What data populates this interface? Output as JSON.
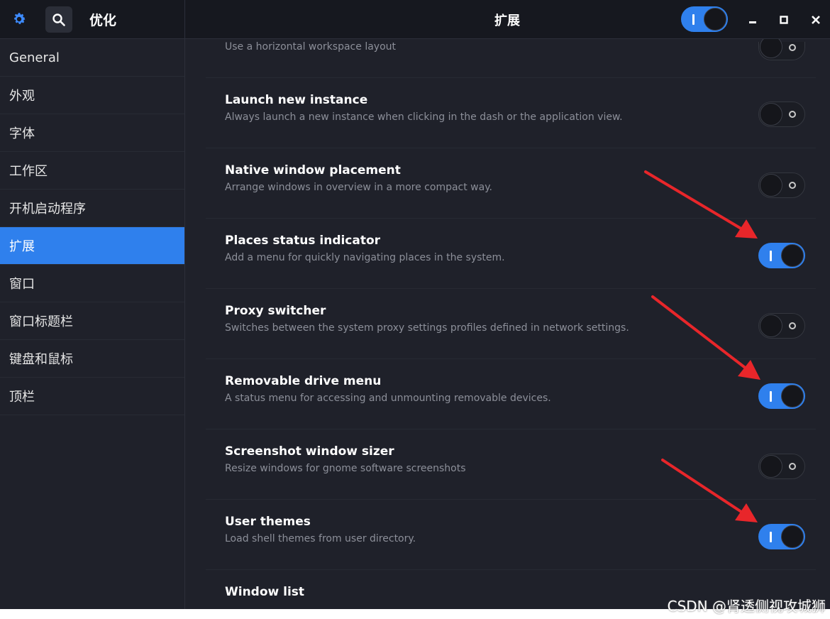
{
  "header": {
    "app_title": "优化",
    "page_title": "扩展",
    "extensions_master_enabled": true
  },
  "sidebar": {
    "items": [
      {
        "label": "General",
        "active": false
      },
      {
        "label": "外观",
        "active": false
      },
      {
        "label": "字体",
        "active": false
      },
      {
        "label": "工作区",
        "active": false
      },
      {
        "label": "开机启动程序",
        "active": false
      },
      {
        "label": "扩展",
        "active": true
      },
      {
        "label": "窗口",
        "active": false
      },
      {
        "label": "窗口标题栏",
        "active": false
      },
      {
        "label": "键盘和鼠标",
        "active": false
      },
      {
        "label": "顶栏",
        "active": false
      }
    ]
  },
  "extensions": [
    {
      "title": "",
      "description": "Use a horizontal workspace layout",
      "enabled": false
    },
    {
      "title": "Launch new instance",
      "description": "Always launch a new instance when clicking in the dash or the application view.",
      "enabled": false
    },
    {
      "title": "Native window placement",
      "description": "Arrange windows in overview in a more compact way.",
      "enabled": false
    },
    {
      "title": "Places status indicator",
      "description": "Add a menu for quickly navigating places in the system.",
      "enabled": true
    },
    {
      "title": "Proxy switcher",
      "description": "Switches between the system proxy settings profiles defined in network settings.",
      "enabled": false
    },
    {
      "title": "Removable drive menu",
      "description": "A status menu for accessing and unmounting removable devices.",
      "enabled": true
    },
    {
      "title": "Screenshot window sizer",
      "description": "Resize windows for gnome software screenshots",
      "enabled": false
    },
    {
      "title": "User themes",
      "description": "Load shell themes from user directory.",
      "enabled": true
    },
    {
      "title": "Window list",
      "description": "",
      "enabled": false
    }
  ],
  "watermark": "CSDN @肾透侧视攻城狮",
  "colors": {
    "accent": "#2f80ed",
    "annotation_arrow": "#e8262a",
    "background": "#1f212a",
    "header": "#16181f"
  },
  "icons": {
    "settings": "gear-icon",
    "search": "search-icon",
    "minimize": "minimize-icon",
    "maximize": "maximize-icon",
    "close": "close-icon"
  }
}
